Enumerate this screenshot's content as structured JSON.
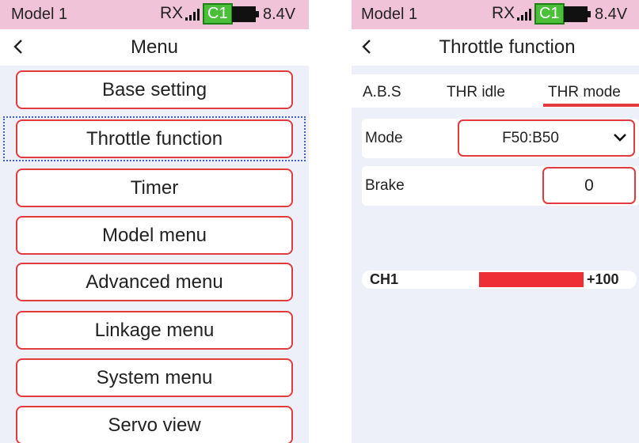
{
  "left": {
    "status": {
      "model": "Model 1",
      "rx": "RX",
      "channel": "C1",
      "voltage": "8.4V"
    },
    "header": {
      "title": "Menu"
    },
    "menu_items": [
      {
        "label": "Base setting"
      },
      {
        "label": "Throttle function"
      },
      {
        "label": "Timer"
      },
      {
        "label": "Model menu"
      },
      {
        "label": "Advanced menu"
      },
      {
        "label": "Linkage menu"
      },
      {
        "label": "System menu"
      },
      {
        "label": "Servo view"
      }
    ],
    "selected_item": "Throttle function"
  },
  "right": {
    "status": {
      "model": "Model 1",
      "rx": "RX",
      "channel": "C1",
      "voltage": "8.4V"
    },
    "header": {
      "title": "Throttle function"
    },
    "tabs": [
      {
        "label": "A.B.S"
      },
      {
        "label": "THR idle"
      },
      {
        "label": "THR mode"
      }
    ],
    "active_tab": "THR mode",
    "mode": {
      "label": "Mode",
      "value": "F50:B50"
    },
    "brake": {
      "label": "Brake",
      "value": "0"
    },
    "channel_monitor": {
      "label": "CH1",
      "value_text": "+100",
      "level_percent": 100
    }
  },
  "colors": {
    "status_bar": "#f1c3d8",
    "accent_red": "#e23a3f",
    "channel_badge": "#4bbf3a",
    "background": "#edf0f8"
  },
  "icons": [
    "back-arrow-icon",
    "signal-icon",
    "battery-icon",
    "chevron-down-icon"
  ]
}
